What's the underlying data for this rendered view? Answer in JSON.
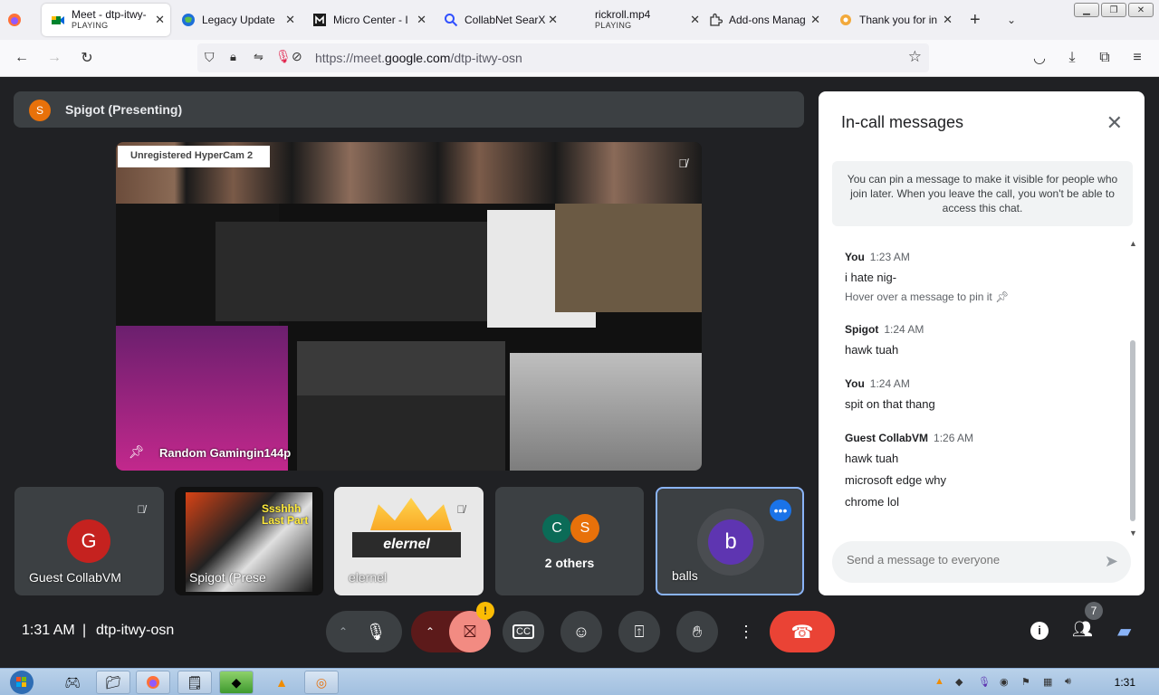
{
  "browser": {
    "tabs": [
      {
        "title": "Meet - dtp-itwy-",
        "status": "PLAYING",
        "icon": "google-meet-icon",
        "active": true
      },
      {
        "title": "Legacy Update",
        "icon": "globe-icon"
      },
      {
        "title": "Micro Center - I",
        "icon": "microcenter-icon"
      },
      {
        "title": "CollabNet SearX",
        "icon": "search-icon"
      },
      {
        "title": "rickroll.mp4",
        "status": "PLAYING",
        "icon": ""
      },
      {
        "title": "Add-ons Manag",
        "icon": "puzzle-icon"
      },
      {
        "title": "Thank you for in",
        "icon": "gear-icon"
      }
    ],
    "url_prefix": "https://meet.",
    "url_domain": "google.com",
    "url_path": "/dtp-itwy-osn"
  },
  "presenter": {
    "initial": "S",
    "label": "Spigot (Presenting)"
  },
  "share": {
    "hypercam": "Unregistered HyperCam 2",
    "name": "Random Gamingin144p"
  },
  "tiles": [
    {
      "name": "Guest CollabVM",
      "initial": "G",
      "color": "#c5221f"
    },
    {
      "name": "Spigot (Prese",
      "overlay": "Ssshhh Last Part"
    },
    {
      "name": "elernel",
      "overlay": "elernel"
    },
    {
      "name": "2 others",
      "initials": [
        "C",
        "S"
      ],
      "colors": [
        "#0b6b57",
        "#e8710a"
      ]
    },
    {
      "name": "balls",
      "initial": "b",
      "color": "#5e35b1"
    }
  ],
  "meeting": {
    "time": "1:31 AM",
    "separator": "|",
    "code": "dtp-itwy-osn",
    "people_count": "7",
    "camera_alert": "!"
  },
  "chat": {
    "title": "In-call messages",
    "info": "You can pin a message to make it visible for people who join later. When you leave the call, you won't be able to access this chat.",
    "messages": [
      {
        "sender": "You",
        "time": "1:23 AM",
        "texts": [
          "i hate nig-"
        ],
        "hint": "Hover over a message to pin it"
      },
      {
        "sender": "Spigot",
        "time": "1:24 AM",
        "texts": [
          "hawk tuah"
        ]
      },
      {
        "sender": "You",
        "time": "1:24 AM",
        "texts": [
          "spit on that thang"
        ]
      },
      {
        "sender": "Guest CollabVM",
        "time": "1:26 AM",
        "texts": [
          "hawk tuah",
          "microsoft edge why",
          "chrome lol"
        ]
      }
    ],
    "input_placeholder": "Send a message to everyone"
  },
  "taskbar": {
    "clock": "1:31"
  },
  "colors": {
    "meet_bg": "#202124",
    "tile_bg": "#3c4043",
    "end_call": "#ea4335",
    "accent": "#1a73e8",
    "chat_icon": "#8ab4f8"
  }
}
